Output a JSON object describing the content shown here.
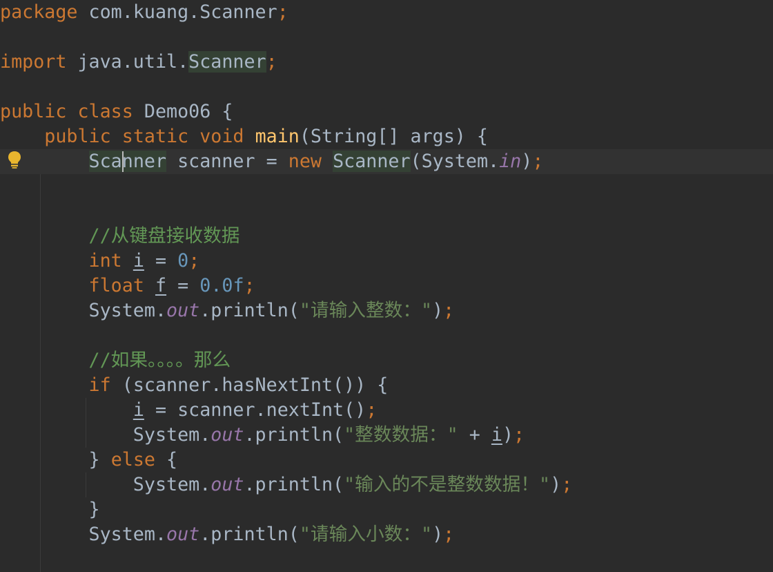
{
  "editor": {
    "language": "java",
    "theme": "darcula",
    "caret_line": 7,
    "lines": [
      {
        "n": 1,
        "tokens": [
          [
            "kw",
            "package"
          ],
          [
            "plain",
            " com.kuang.Scanner"
          ],
          [
            "kw",
            ";"
          ]
        ]
      },
      {
        "n": 2,
        "tokens": []
      },
      {
        "n": 3,
        "tokens": [
          [
            "kw",
            "import"
          ],
          [
            "plain",
            " java.util."
          ],
          [
            "hl",
            "Scanner"
          ],
          [
            "kw",
            ";"
          ]
        ]
      },
      {
        "n": 4,
        "tokens": []
      },
      {
        "n": 5,
        "tokens": [
          [
            "kw",
            "public class"
          ],
          [
            "plain",
            " Demo06 {"
          ]
        ]
      },
      {
        "n": 6,
        "tokens": [
          [
            "plain",
            "    "
          ],
          [
            "kw",
            "public static void"
          ],
          [
            "plain",
            " "
          ],
          [
            "method",
            "main"
          ],
          [
            "plain",
            "(String[] args) {"
          ]
        ]
      },
      {
        "n": 7,
        "tokens": [
          [
            "plain",
            "        "
          ],
          [
            "hl",
            "Scanner"
          ],
          [
            "plain",
            " scanner = "
          ],
          [
            "kw",
            "new"
          ],
          [
            "plain",
            " "
          ],
          [
            "hl",
            "Scanner"
          ],
          [
            "plain",
            "(System."
          ],
          [
            "static",
            "in"
          ],
          [
            "plain",
            ")"
          ],
          [
            "kw",
            ";"
          ]
        ]
      },
      {
        "n": 8,
        "tokens": []
      },
      {
        "n": 9,
        "tokens": []
      },
      {
        "n": 10,
        "tokens": [
          [
            "plain",
            "        "
          ],
          [
            "comment",
            "//从键盘接收数据"
          ]
        ]
      },
      {
        "n": 11,
        "tokens": [
          [
            "plain",
            "        "
          ],
          [
            "kw",
            "int"
          ],
          [
            "plain",
            " "
          ],
          [
            "var",
            "i"
          ],
          [
            "plain",
            " = "
          ],
          [
            "num",
            "0"
          ],
          [
            "kw",
            ";"
          ]
        ]
      },
      {
        "n": 12,
        "tokens": [
          [
            "plain",
            "        "
          ],
          [
            "kw",
            "float"
          ],
          [
            "plain",
            " "
          ],
          [
            "var",
            "f"
          ],
          [
            "plain",
            " = "
          ],
          [
            "num",
            "0.0f"
          ],
          [
            "kw",
            ";"
          ]
        ]
      },
      {
        "n": 13,
        "tokens": [
          [
            "plain",
            "        System."
          ],
          [
            "static",
            "out"
          ],
          [
            "plain",
            ".println("
          ],
          [
            "str",
            "\"请输入整数：\""
          ],
          [
            "plain",
            ")"
          ],
          [
            "kw",
            ";"
          ]
        ]
      },
      {
        "n": 14,
        "tokens": []
      },
      {
        "n": 15,
        "tokens": [
          [
            "plain",
            "        "
          ],
          [
            "comment",
            "//如果。。。。那么"
          ]
        ]
      },
      {
        "n": 16,
        "tokens": [
          [
            "plain",
            "        "
          ],
          [
            "kw",
            "if"
          ],
          [
            "plain",
            " (scanner.hasNextInt()) {"
          ]
        ]
      },
      {
        "n": 17,
        "tokens": [
          [
            "plain",
            "            "
          ],
          [
            "var",
            "i"
          ],
          [
            "plain",
            " = scanner.nextInt()"
          ],
          [
            "kw",
            ";"
          ]
        ]
      },
      {
        "n": 18,
        "tokens": [
          [
            "plain",
            "            System."
          ],
          [
            "static",
            "out"
          ],
          [
            "plain",
            ".println("
          ],
          [
            "str",
            "\"整数数据：\""
          ],
          [
            "plain",
            " + "
          ],
          [
            "var",
            "i"
          ],
          [
            "plain",
            ")"
          ],
          [
            "kw",
            ";"
          ]
        ]
      },
      {
        "n": 19,
        "tokens": [
          [
            "plain",
            "        } "
          ],
          [
            "kw",
            "else"
          ],
          [
            "plain",
            " {"
          ]
        ]
      },
      {
        "n": 20,
        "tokens": [
          [
            "plain",
            "            System."
          ],
          [
            "static",
            "out"
          ],
          [
            "plain",
            ".println("
          ],
          [
            "str",
            "\"输入的不是整数数据！\""
          ],
          [
            "plain",
            ")"
          ],
          [
            "kw",
            ";"
          ]
        ]
      },
      {
        "n": 21,
        "tokens": [
          [
            "plain",
            "        }"
          ]
        ]
      },
      {
        "n": 22,
        "tokens": [
          [
            "plain",
            "        System."
          ],
          [
            "static",
            "out"
          ],
          [
            "plain",
            ".println("
          ],
          [
            "str",
            "\"请输入小数：\""
          ],
          [
            "plain",
            ")"
          ],
          [
            "kw",
            ";"
          ]
        ]
      }
    ]
  },
  "gutter": {
    "intention_icon": "lightbulb-icon",
    "intention_color": "#e8b52e"
  }
}
